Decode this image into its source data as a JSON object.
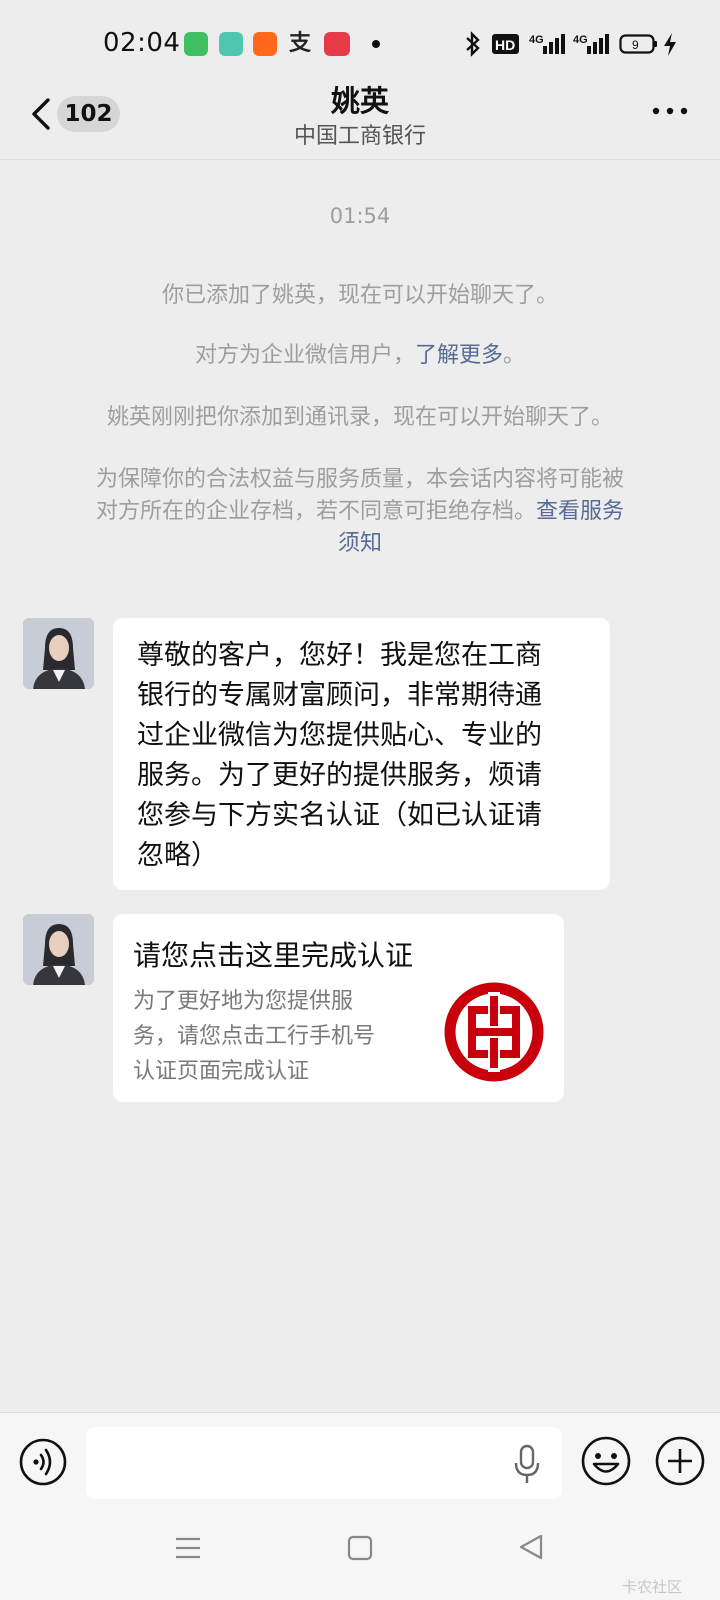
{
  "status_bar": {
    "time": "02:04",
    "app_icons": [
      "messages-icon",
      "download-icon",
      "taobao-icon",
      "alipay-icon",
      "app-icon"
    ],
    "hd_label": "HD",
    "signal_label": "4G",
    "battery": "9"
  },
  "header": {
    "back_count": "102",
    "title": "姚英",
    "subtitle": "中国工商银行"
  },
  "system_messages": {
    "time": "01:54",
    "added": "你已添加了姚英，现在可以开始聊天了。",
    "enterprise_prefix": "对方为企业微信用户，",
    "enterprise_link": "了解更多",
    "enterprise_suffix": "。",
    "contact_added": "姚英刚刚把你添加到通讯录，现在可以开始聊天了。",
    "archive_line1": "为保障你的合法权益与服务质量，本会话内容将可能被",
    "archive_line2": "对方所在的企业存档，若不同意可拒绝存档。",
    "archive_link1": "查看服务",
    "archive_link2": "须知"
  },
  "messages": [
    {
      "lines": [
        "尊敬的客户，您好！我是您在工商",
        "银行的专属财富顾问，非常期待通",
        "过企业微信为您提供贴心、专业的",
        "服务。为了更好的提供服务，烦请",
        "您参与下方实名认证（如已认证请",
        "忽略）"
      ]
    },
    {
      "card_title": "请您点击这里完成认证",
      "card_desc": [
        "为了更好地为您提供服",
        "务，请您点击工行手机号",
        "认证页面完成认证"
      ]
    }
  ],
  "input_bar": {
    "placeholder": ""
  },
  "watermark": "卡农社区",
  "colors": {
    "background": "#ededed",
    "link": "#576b95",
    "icbc_red": "#c7000b"
  }
}
